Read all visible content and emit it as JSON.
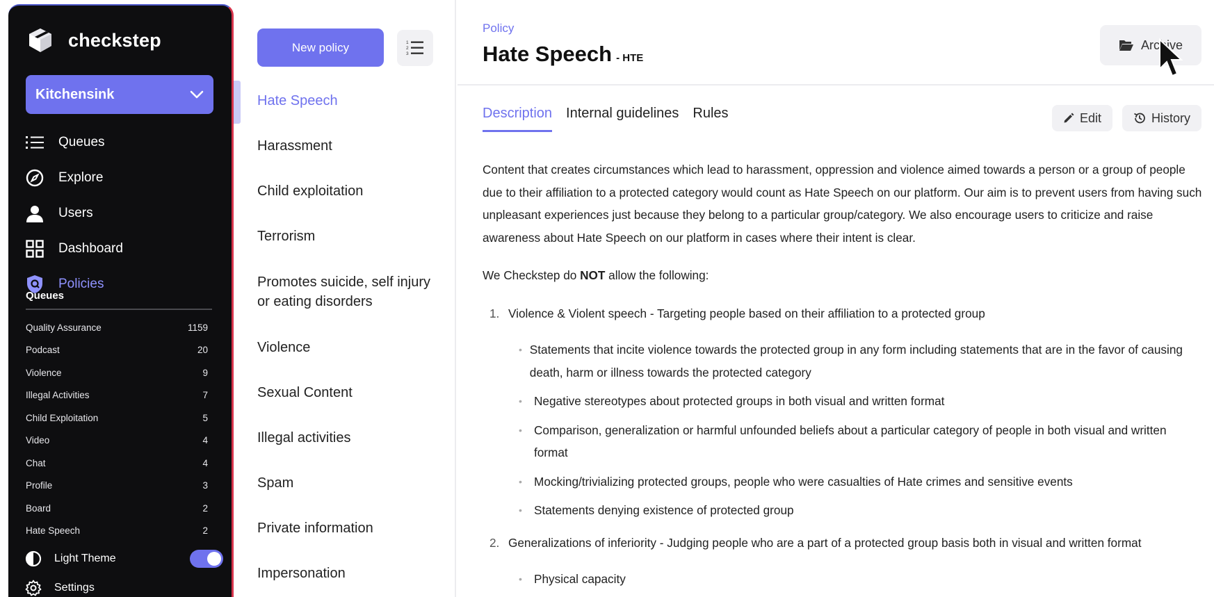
{
  "brand": {
    "name": "checkstep"
  },
  "workspace": {
    "label": "Kitchensink"
  },
  "nav": [
    {
      "label": "Queues",
      "icon": "list-icon"
    },
    {
      "label": "Explore",
      "icon": "compass-icon"
    },
    {
      "label": "Users",
      "icon": "user-icon"
    },
    {
      "label": "Dashboard",
      "icon": "grid-icon"
    },
    {
      "label": "Policies",
      "icon": "shield-icon"
    }
  ],
  "queues": {
    "title": "Queues",
    "items": [
      {
        "name": "Quality Assurance",
        "count": "1159"
      },
      {
        "name": "Podcast",
        "count": "20"
      },
      {
        "name": "Violence",
        "count": "9"
      },
      {
        "name": "Illegal Activities",
        "count": "7"
      },
      {
        "name": "Child Exploitation",
        "count": "5"
      },
      {
        "name": "Video",
        "count": "4"
      },
      {
        "name": "Chat",
        "count": "4"
      },
      {
        "name": "Profile",
        "count": "3"
      },
      {
        "name": "Board",
        "count": "2"
      },
      {
        "name": "Hate Speech",
        "count": "2"
      }
    ]
  },
  "bottom": {
    "theme_label": "Light Theme",
    "settings_label": "Settings"
  },
  "middle": {
    "new_policy_label": "New policy",
    "policies": [
      "Hate Speech",
      "Harassment",
      "Child exploitation",
      "Terrorism",
      "Promotes suicide, self injury or eating disorders",
      "Violence",
      "Sexual Content",
      "Illegal activities",
      "Spam",
      "Private information",
      "Impersonation"
    ]
  },
  "main": {
    "breadcrumb": "Policy",
    "title": "Hate Speech",
    "code": "- HTE",
    "archive_label": "Archive",
    "tabs": [
      "Description",
      "Internal guidelines",
      "Rules"
    ],
    "edit_label": "Edit",
    "history_label": "History",
    "intro": "Content that creates circumstances which lead to harassment, oppression and violence aimed towards a person or a group of people due to their affiliation to a protected category would count as Hate Speech on our platform. Our aim is to prevent users from having such unpleasant experiences just because they belong to a particular group/category. We also encourage users to criticize and raise awareness about Hate Speech on our platform in cases where their intent is clear.",
    "not_allowed_prefix": "We Checkstep do ",
    "not_allowed_bold": "NOT",
    "not_allowed_suffix": " allow the following:",
    "rules": [
      {
        "num": "1.",
        "text": "Violence & Violent speech - Targeting people based on their affiliation to a protected group",
        "bullets": [
          "Statements that incite violence towards the protected group in any form including statements that are in the favor of causing death, harm or illness towards the protected category",
          "Negative stereotypes about protected groups in both visual and written format",
          "Comparison, generalization or harmful unfounded beliefs about a particular category of people in both visual and written format",
          "Mocking/trivializing protected groups, people who were casualties of Hate crimes and sensitive events",
          "Statements denying existence of protected group"
        ]
      },
      {
        "num": "2.",
        "text": "Generalizations of inferiority - Judging people who are a part of a protected group basis both in visual and written format",
        "bullets": [
          "Physical capacity"
        ]
      }
    ]
  },
  "colors": {
    "accent": "#6f72ee",
    "sidebar_bg": "#0e0e10"
  }
}
